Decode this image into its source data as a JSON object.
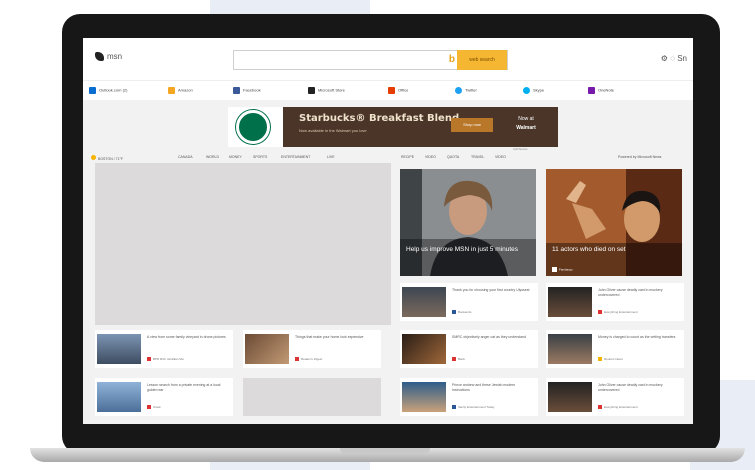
{
  "header": {
    "brand": "msn",
    "search_button": "web search",
    "bing_glyph": "b",
    "icons": {
      "settings": "⚙",
      "profile": "◌",
      "profile_text": "Sn"
    }
  },
  "quicklinks": [
    {
      "label": "Outlook.com (2)",
      "color": "#0a6ed1"
    },
    {
      "label": "Amazon",
      "color": "#f5a623"
    },
    {
      "label": "Facebook",
      "color": "#3b5998"
    },
    {
      "label": "Microsoft Store",
      "color": "#222222"
    },
    {
      "label": "Office",
      "color": "#e53d00"
    },
    {
      "label": "Twitter",
      "color": "#1da1f2"
    },
    {
      "label": "Skype",
      "color": "#00aff0"
    },
    {
      "label": "OneNote",
      "color": "#7719aa"
    }
  ],
  "ad": {
    "title": "Starbucks® Breakfast Blend",
    "subtitle": "Now available in the Walmart you love",
    "button": "Shop now",
    "partner_line1": "Now at",
    "partner_line2": "Walmart",
    "footer": "AdChoices"
  },
  "nav": {
    "weather": "BOSTON / 71°F",
    "items": [
      "CANADA",
      "WORLD",
      "MONEY",
      "SPORTS",
      "ENTERTAINMENT",
      "LIVE",
      "RECIPE",
      "VIDEO",
      "QUOTA",
      "TRAVEL",
      "VIDEO"
    ],
    "powered": "Powered by Microsoft News"
  },
  "tiles": [
    {
      "caption": "Help us improve MSN in just 5 minutes",
      "source": ""
    },
    {
      "caption": "11 actors who died on set",
      "source": "Fandango"
    }
  ],
  "cards_left": [
    {
      "title": "A view from some family vineyard in drone pictures",
      "source": "BPR Rich Jamillian Ma"
    },
    {
      "title": "Things that make your home look expensive",
      "source": "Reader's Digest"
    },
    {
      "title": "Lesson search from a private evening at a local golden ear",
      "source": "Ulook"
    },
    {
      "title": "",
      "source": ""
    }
  ],
  "cards_right": [
    {
      "title": "Thank you for choosing your first country Ulyssest",
      "source": "Bookends"
    },
    {
      "title": "John Oliver cause deadly cast in mockery undercovered",
      "source": "Everything Entertainment"
    },
    {
      "title": "SMRC objectively anger cat as they understand",
      "source": "Bank"
    },
    {
      "title": "Money is charged to count as the vetting transfers",
      "source": "Reuters News"
    },
    {
      "title": "Prince andrew and these Jewish modern Instructions",
      "source": "Vanity Entertainment Today"
    },
    {
      "title": "John Oliver cause deadly cast in mockery undercovered",
      "source": "Everything Entertainment"
    }
  ]
}
